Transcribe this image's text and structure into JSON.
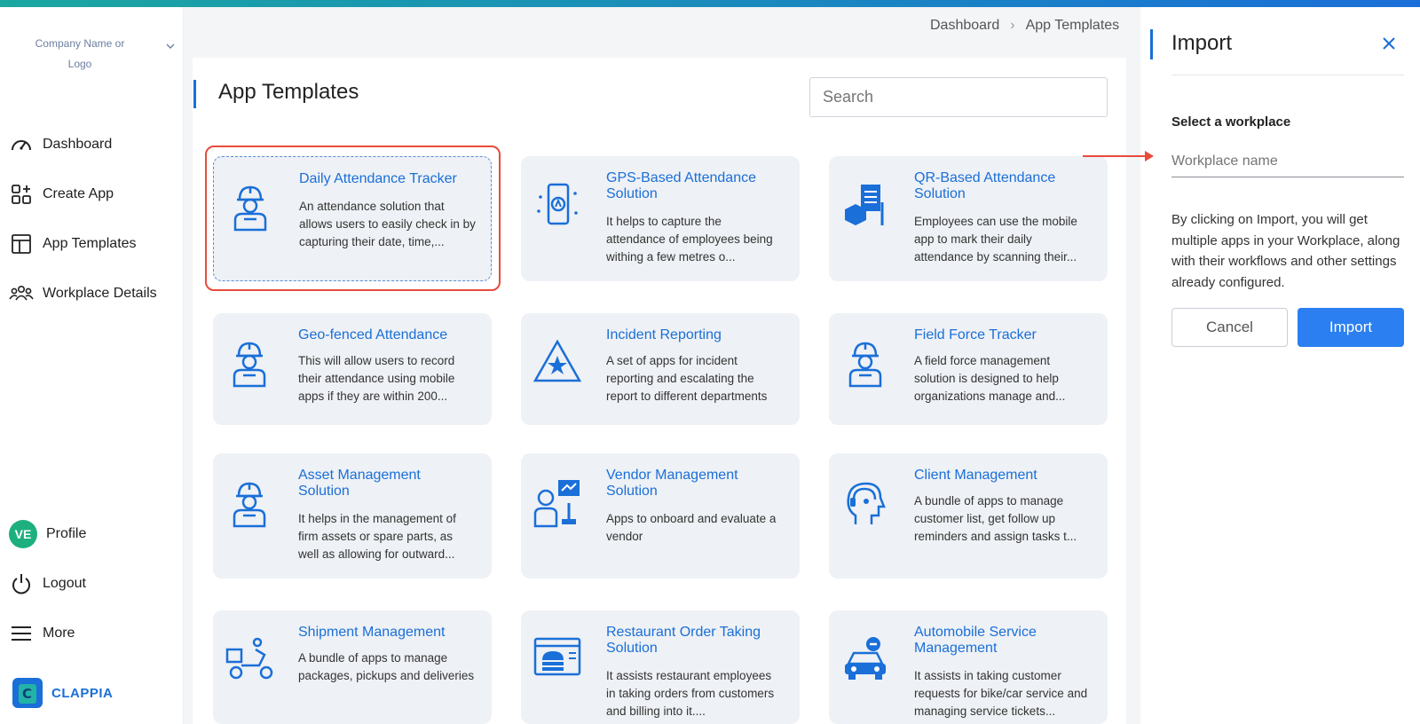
{
  "company": {
    "label": "Company Name or Logo"
  },
  "sidebar": {
    "items": [
      {
        "label": "Dashboard",
        "icon": "dashboard-gauge-icon"
      },
      {
        "label": "Create App",
        "icon": "create-app-grid-icon"
      },
      {
        "label": "App Templates",
        "icon": "templates-layout-icon"
      },
      {
        "label": "Workplace Details",
        "icon": "users-group-icon"
      }
    ],
    "bottom": [
      {
        "label": "Profile",
        "avatar": "VE"
      },
      {
        "label": "Logout",
        "icon": "power-icon"
      },
      {
        "label": "More",
        "icon": "menu-icon"
      }
    ],
    "brand": "CLAPPIA"
  },
  "breadcrumb": {
    "items": [
      "Dashboard",
      "App Templates"
    ]
  },
  "main": {
    "title": "App Templates",
    "search_placeholder": "Search",
    "cards": [
      {
        "title": "Daily Attendance Tracker",
        "desc": "An attendance solution that allows users to easily check in by capturing their date, time,...",
        "icon": "worker-icon"
      },
      {
        "title": "GPS-Based Attendance Solution",
        "desc": "It helps to capture the attendance of employees being withing a few metres o...",
        "icon": "phone-location-icon"
      },
      {
        "title": "QR-Based Attendance Solution",
        "desc": "Employees can use the mobile app to mark their daily attendance by scanning their...",
        "icon": "documents-box-icon"
      },
      {
        "title": "Geo-fenced Attendance",
        "desc": "This will allow users to record their attendance using mobile apps if they are within 200...",
        "icon": "worker-icon"
      },
      {
        "title": "Incident Reporting",
        "desc": "A set of apps for incident reporting and escalating the report to different departments",
        "icon": "warning-triangle-icon"
      },
      {
        "title": "Field Force Tracker",
        "desc": "A field force management solution is designed to help organizations manage and...",
        "icon": "worker-icon"
      },
      {
        "title": "Asset Management Solution",
        "desc": "It helps in the management of firm assets or spare parts, as well as allowing for outward...",
        "icon": "worker-icon"
      },
      {
        "title": "Vendor Management Solution",
        "desc": "Apps to onboard and evaluate a vendor",
        "icon": "vendor-presentation-icon"
      },
      {
        "title": "Client Management",
        "desc": "A bundle of apps to manage customer list, get follow up reminders and assign tasks t...",
        "icon": "head-headset-icon"
      },
      {
        "title": "Shipment Management",
        "desc": "A bundle of apps to manage packages, pickups and deliveries",
        "icon": "delivery-scooter-icon"
      },
      {
        "title": "Restaurant Order Taking Solution",
        "desc": "It assists restaurant employees in taking orders from customers and billing into it....",
        "icon": "burger-screen-icon"
      },
      {
        "title": "Automobile Service Management",
        "desc": "It assists in taking customer requests for bike/car service and managing service tickets...",
        "icon": "car-wrench-icon"
      }
    ]
  },
  "import_panel": {
    "title": "Import",
    "select_label": "Select a workplace",
    "workplace_placeholder": "Workplace name",
    "info": "By clicking on Import, you will get multiple apps in your Workplace, along with their workflows and other settings already configured.",
    "cancel_label": "Cancel",
    "import_label": "Import"
  },
  "colors": {
    "accent": "#1a6fd8",
    "highlight": "#e84b3c",
    "import_button": "#2b7ff0",
    "card_bg": "#eef1f5"
  }
}
